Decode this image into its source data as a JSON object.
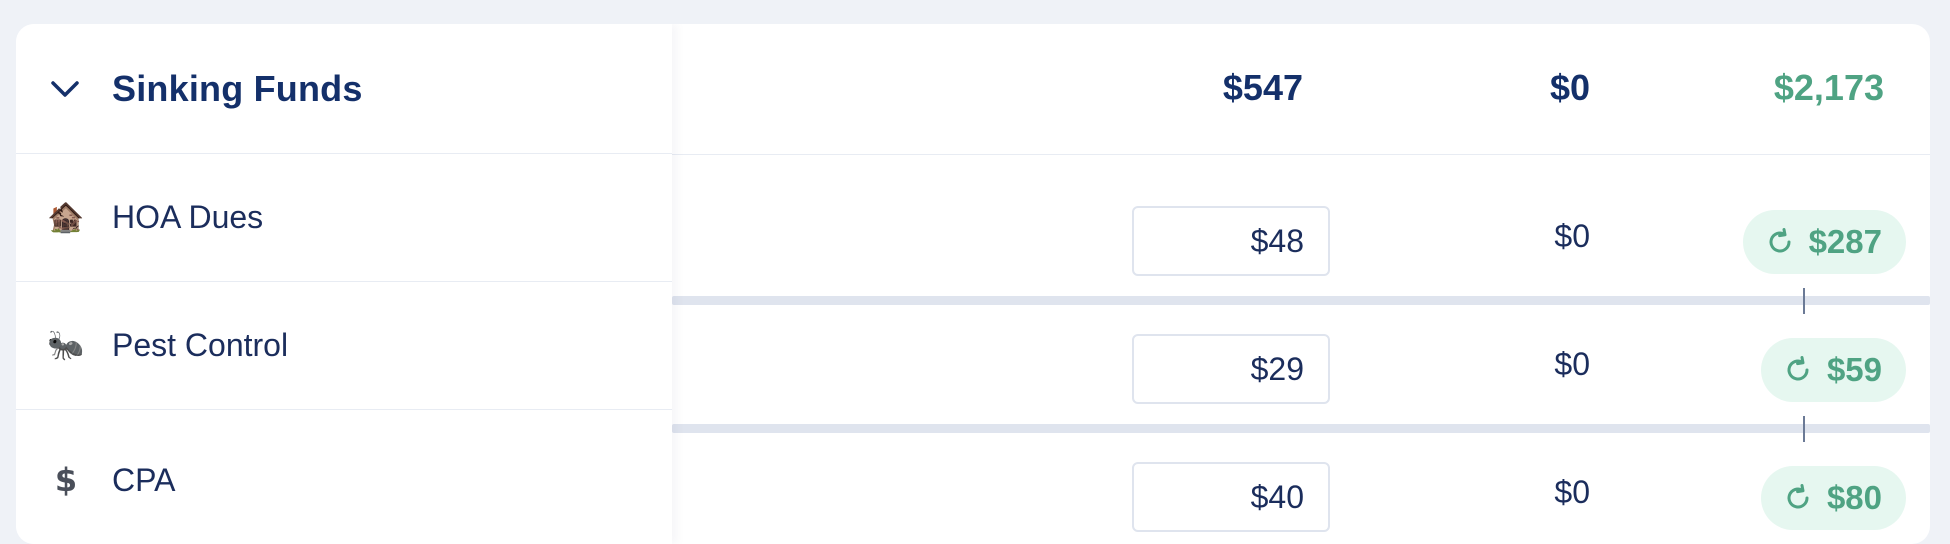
{
  "group": {
    "title": "Sinking Funds",
    "assigned_total": "$547",
    "activity_total": "$0",
    "available_total": "$2,173"
  },
  "items": [
    {
      "emoji": "🏚️",
      "icon_name": "house-icon",
      "label": "HOA Dues",
      "assigned": "$48",
      "activity": "$0",
      "available": "$287"
    },
    {
      "emoji": "🐜",
      "icon_name": "ant-icon",
      "label": "Pest Control",
      "assigned": "$29",
      "activity": "$0",
      "available": "$59"
    },
    {
      "emoji": "$",
      "icon_name": "dollar-icon",
      "label": "CPA",
      "assigned": "$40",
      "activity": "$0",
      "available": "$80"
    }
  ],
  "colors": {
    "accent_text": "#14306a",
    "available_green": "#4fa383",
    "available_pill_bg": "#e6f7f0",
    "page_bg": "#eff2f7"
  }
}
